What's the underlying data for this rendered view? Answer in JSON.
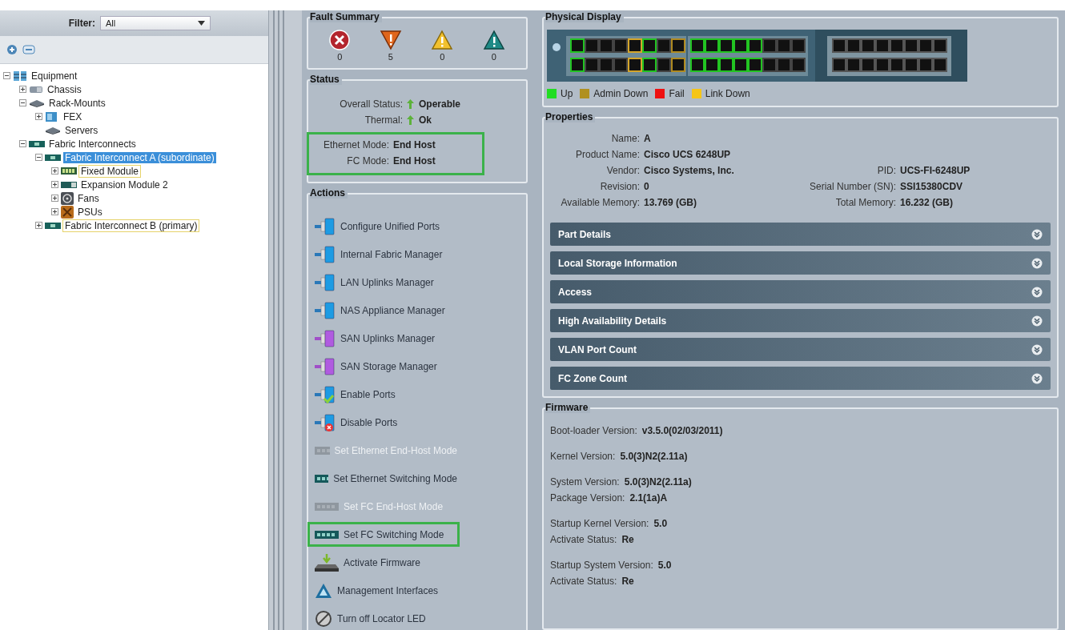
{
  "navigation": {
    "filter": {
      "label": "Filter:",
      "value": "All"
    },
    "tree": [
      {
        "label": "Equipment",
        "kind": "equipment",
        "expanded": true,
        "selected": false,
        "outlined": false,
        "children": [
          {
            "label": "Chassis",
            "kind": "chassis",
            "expanded": false,
            "selected": false,
            "outlined": false
          },
          {
            "label": "Rack-Mounts",
            "kind": "rack",
            "expanded": true,
            "selected": false,
            "outlined": false,
            "children": [
              {
                "label": "FEX",
                "kind": "fex",
                "expanded": false,
                "selected": false,
                "outlined": false
              },
              {
                "label": "Servers",
                "kind": "rack",
                "selected": false,
                "outlined": false
              }
            ]
          },
          {
            "label": "Fabric Interconnects",
            "kind": "interconnect",
            "expanded": true,
            "selected": false,
            "outlined": false,
            "children": [
              {
                "label": "Fabric Interconnect A (subordinate)",
                "kind": "interconnect",
                "expanded": true,
                "selected": true,
                "outlined": false,
                "children": [
                  {
                    "label": "Fixed Module",
                    "kind": "module",
                    "expanded": false,
                    "selected": false,
                    "outlined": true
                  },
                  {
                    "label": "Expansion Module 2",
                    "kind": "expansion",
                    "expanded": false,
                    "selected": false,
                    "outlined": false
                  },
                  {
                    "label": "Fans",
                    "kind": "fan",
                    "expanded": false,
                    "selected": false,
                    "outlined": false
                  },
                  {
                    "label": "PSUs",
                    "kind": "psu",
                    "expanded": false,
                    "selected": false,
                    "outlined": false
                  }
                ]
              },
              {
                "label": "Fabric Interconnect B (primary)",
                "kind": "interconnect",
                "expanded": false,
                "selected": false,
                "outlined": true
              }
            ]
          }
        ]
      }
    ]
  },
  "fault_summary": {
    "title": "Fault Summary",
    "faults": [
      {
        "kind": "critical",
        "count": "0"
      },
      {
        "kind": "major",
        "count": "5"
      },
      {
        "kind": "minor",
        "count": "0"
      },
      {
        "kind": "warning",
        "count": "0"
      }
    ]
  },
  "status": {
    "title": "Status",
    "rows": [
      {
        "label": "Overall Status:",
        "value": "Operable",
        "kind": "up"
      },
      {
        "label": "Thermal:",
        "value": "Ok",
        "kind": "up"
      }
    ],
    "modes": {
      "highlighted": true,
      "rows": [
        {
          "label": "Ethernet Mode:",
          "value": "End Host"
        },
        {
          "label": "FC Mode:",
          "value": "End Host"
        }
      ]
    }
  },
  "actions": {
    "title": "Actions",
    "items": [
      {
        "label": "Configure Unified Ports",
        "kind": "port-blue",
        "disabled": false,
        "highlighted": false
      },
      {
        "label": "Internal Fabric Manager",
        "kind": "port-blue",
        "disabled": false,
        "highlighted": false
      },
      {
        "label": "LAN Uplinks Manager",
        "kind": "port-blue",
        "disabled": false,
        "highlighted": false
      },
      {
        "label": "NAS Appliance Manager",
        "kind": "port-blue",
        "disabled": false,
        "highlighted": false
      },
      {
        "label": "SAN Uplinks Manager",
        "kind": "port-purple",
        "disabled": false,
        "highlighted": false
      },
      {
        "label": "SAN Storage Manager",
        "kind": "port-purple",
        "disabled": false,
        "highlighted": false
      },
      {
        "label": "Enable Ports",
        "kind": "enable",
        "disabled": false,
        "highlighted": false
      },
      {
        "label": "Disable Ports",
        "kind": "disable",
        "disabled": false,
        "highlighted": false
      },
      {
        "label": "Set Ethernet End-Host Mode",
        "kind": "module",
        "disabled": true,
        "highlighted": false
      },
      {
        "label": "Set Ethernet Switching Mode",
        "kind": "module",
        "disabled": false,
        "highlighted": false
      },
      {
        "label": "Set FC End-Host Mode",
        "kind": "module",
        "disabled": true,
        "highlighted": false
      },
      {
        "label": "Set FC Switching Mode",
        "kind": "module",
        "disabled": false,
        "highlighted": true
      },
      {
        "label": "Activate Firmware",
        "kind": "firmware",
        "disabled": false,
        "highlighted": false
      },
      {
        "label": "Management Interfaces",
        "kind": "management",
        "disabled": false,
        "highlighted": false
      },
      {
        "label": "Turn off Locator LED",
        "kind": "locator",
        "disabled": false,
        "highlighted": false
      }
    ]
  },
  "physical_display": {
    "title": "Physical Display",
    "legend": [
      {
        "label": "Up",
        "color": "#22dd22"
      },
      {
        "label": "Admin Down",
        "color": "#b09020"
      },
      {
        "label": "Fail",
        "color": "#ee1111"
      },
      {
        "label": "Link Down",
        "color": "#f5c518"
      }
    ]
  },
  "properties": {
    "title": "Properties",
    "rows": [
      [
        {
          "label": "Name:",
          "value": "A"
        }
      ],
      [
        {
          "label": "Product Name:",
          "value": "Cisco UCS 6248UP"
        }
      ],
      [
        {
          "label": "Vendor:",
          "value": "Cisco Systems, Inc."
        },
        {
          "label": "PID:",
          "value": "UCS-FI-6248UP"
        }
      ],
      [
        {
          "label": "Revision:",
          "value": "0"
        },
        {
          "label": "Serial Number (SN):",
          "value": "SSI15380CDV"
        }
      ],
      [
        {
          "label": "Available Memory:",
          "value": "13.769 (GB)"
        },
        {
          "label": "Total Memory:",
          "value": "16.232 (GB)"
        }
      ]
    ],
    "sections": [
      {
        "label": "Part Details",
        "expanded": false
      },
      {
        "label": "Local Storage Information",
        "expanded": false
      },
      {
        "label": "Access",
        "expanded": false
      },
      {
        "label": "High Availability Details",
        "expanded": false
      },
      {
        "label": "VLAN Port Count",
        "expanded": false
      },
      {
        "label": "FC Zone Count",
        "expanded": false
      }
    ]
  },
  "firmware": {
    "title": "Firmware",
    "groups": [
      [
        {
          "label": "Boot-loader Version:",
          "value": "v3.5.0(02/03/2011)"
        }
      ],
      [
        {
          "label": "Kernel Version:",
          "value": "5.0(3)N2(2.11a)"
        }
      ],
      [
        {
          "label": "System Version:",
          "value": "5.0(3)N2(2.11a)"
        },
        {
          "label": "Package Version:",
          "value": "2.1(1a)A"
        }
      ],
      [
        {
          "label": "Startup Kernel Version:",
          "value": "5.0"
        },
        {
          "label": "Activate Status:",
          "value": "Re"
        }
      ],
      [
        {
          "label": "Startup System Version:",
          "value": "5.0"
        },
        {
          "label": "Activate Status:",
          "value": "Re"
        }
      ]
    ]
  }
}
